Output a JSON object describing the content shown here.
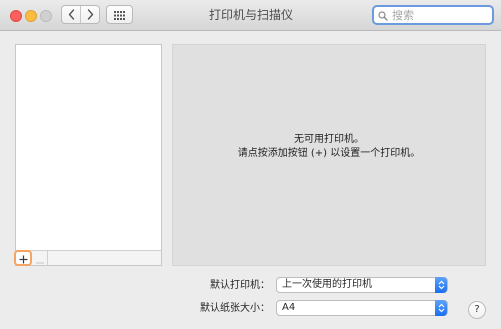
{
  "window": {
    "title": "打印机与扫描仪"
  },
  "toolbar": {
    "back_icon": "chevron-left-icon",
    "forward_icon": "chevron-right-icon",
    "grid_icon": "show-all-grid-icon"
  },
  "search": {
    "placeholder": "搜索",
    "value": "",
    "icon": "search-icon"
  },
  "printer_list": {
    "items": [],
    "add_label": "+",
    "remove_label": "—"
  },
  "detail": {
    "empty_title": "无可用打印机。",
    "empty_hint": "请点按添加按钮 (+) 以设置一个打印机。"
  },
  "settings": {
    "default_printer": {
      "label": "默认打印机：",
      "value": "上一次使用的打印机"
    },
    "default_paper": {
      "label": "默认纸张大小：",
      "value": "A4"
    }
  },
  "help": {
    "label": "?"
  },
  "colors": {
    "close": "#fc605c",
    "minimize": "#fdbc40",
    "zoom_disabled": "#d0d0d0",
    "focus_ring": "#f5a461",
    "search_focus": "#6c9ae0",
    "popup_accent": "#1a6ff0"
  }
}
